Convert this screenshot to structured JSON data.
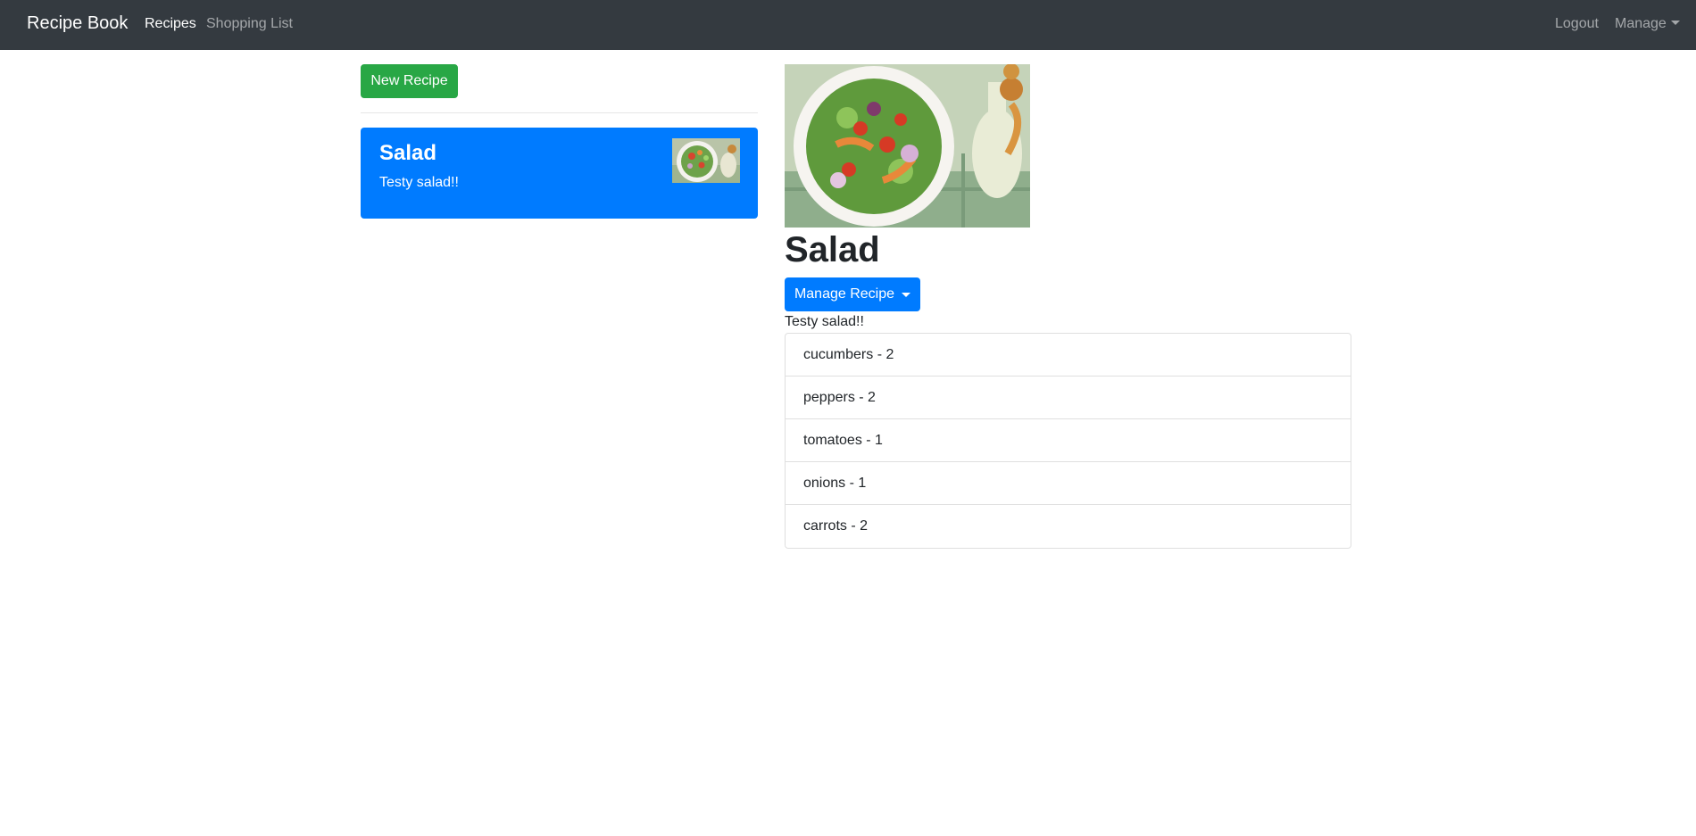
{
  "navbar": {
    "brand": "Recipe Book",
    "links": [
      {
        "label": "Recipes",
        "active": true
      },
      {
        "label": "Shopping List",
        "active": false
      }
    ],
    "logout_label": "Logout",
    "manage_label": "Manage"
  },
  "recipe_list": {
    "new_button_label": "New Recipe",
    "items": [
      {
        "name": "Salad",
        "description": "Testy salad!!"
      }
    ]
  },
  "recipe_detail": {
    "name": "Salad",
    "manage_button_label": "Manage Recipe",
    "description": "Testy salad!!",
    "ingredients": [
      "cucumbers - 2",
      "peppers - 2",
      "tomatoes - 1",
      "onions - 1",
      "carrots - 2"
    ]
  },
  "colors": {
    "navbar_bg": "#343a40",
    "primary": "#007bff",
    "success": "#28a745"
  },
  "icons": [
    "caret-down-icon",
    "salad-photo"
  ]
}
